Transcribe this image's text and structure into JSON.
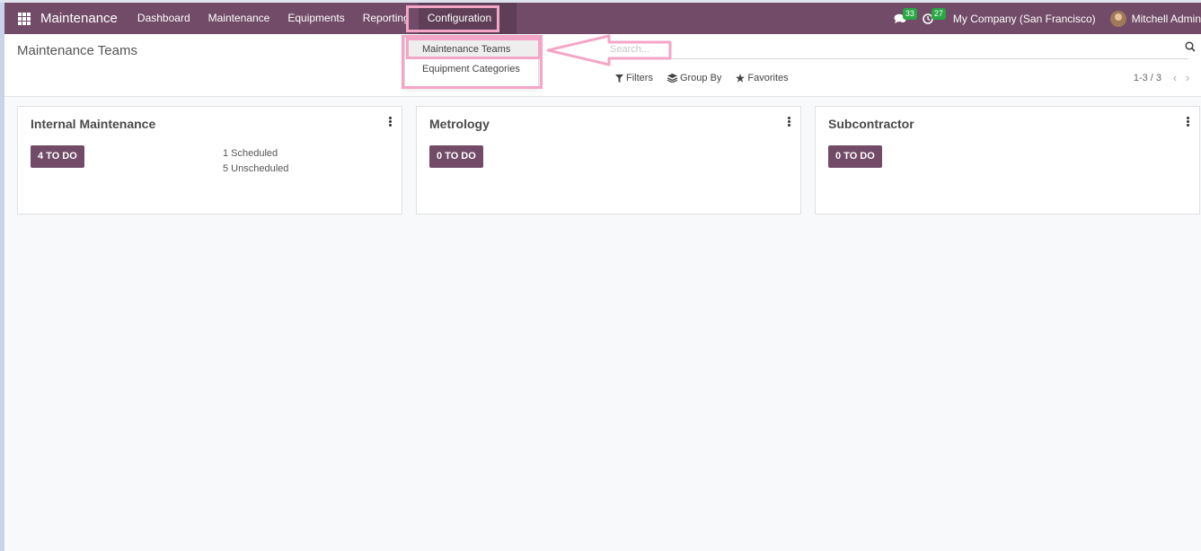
{
  "navbar": {
    "app_name": "Maintenance",
    "menu": [
      "Dashboard",
      "Maintenance",
      "Equipments",
      "Reporting",
      "Configuration"
    ],
    "messages_count": "33",
    "activities_count": "27",
    "company": "My Company (San Francisco)",
    "user": "Mitchell Admin"
  },
  "breadcrumb": "Maintenance Teams",
  "search": {
    "placeholder": "Search..."
  },
  "filters": {
    "filters": "Filters",
    "group_by": "Group By",
    "favorites": "Favorites"
  },
  "pager": {
    "value": "1-3 / 3"
  },
  "dropdown": {
    "items": [
      "Maintenance Teams",
      "Equipment Categories"
    ]
  },
  "teams": [
    {
      "name": "Internal Maintenance",
      "todo": "4 TO DO",
      "scheduled": "1 Scheduled",
      "unscheduled": "5 Unscheduled"
    },
    {
      "name": "Metrology",
      "todo": "0 TO DO"
    },
    {
      "name": "Subcontractor",
      "todo": "0 TO DO"
    }
  ],
  "colors": {
    "primary": "#714b67",
    "badge": "#28a745",
    "annotation": "#f3a6c8"
  }
}
